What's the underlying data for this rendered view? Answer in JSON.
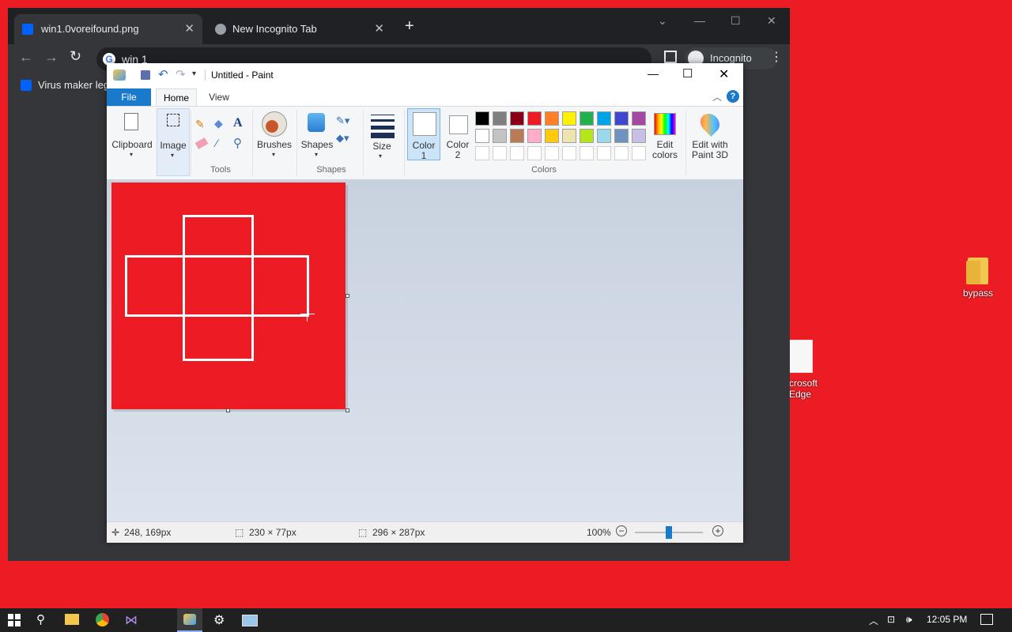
{
  "desktop": {
    "icons": [
      {
        "label": "bypass"
      },
      {
        "label": "crosoft\nEdge"
      }
    ]
  },
  "browser": {
    "tabs": [
      {
        "title": "win1.0voreifound.png"
      },
      {
        "title": "New Incognito Tab"
      }
    ],
    "omnibox_text": "win 1",
    "profile_label": "Incognito",
    "bookmark": "Virus maker legi"
  },
  "paint": {
    "title": "Untitled - Paint",
    "tabs": {
      "file": "File",
      "home": "Home",
      "view": "View"
    },
    "ribbon": {
      "clipboard": "Clipboard",
      "image": "Image",
      "tools_group": "Tools",
      "brushes": "Brushes",
      "shapes": "Shapes",
      "shapes_group": "Shapes",
      "size": "Size",
      "color1": "Color\n1",
      "color2": "Color\n2",
      "colors_group": "Colors",
      "edit_colors": "Edit\ncolors",
      "edit_paint3d": "Edit with\nPaint 3D"
    },
    "palette_row1": [
      "#000000",
      "#7f7f7f",
      "#880015",
      "#ed1c24",
      "#ff7f27",
      "#fff200",
      "#22b14c",
      "#00a2e8",
      "#3f48cc",
      "#a349a4"
    ],
    "palette_row2": [
      "#ffffff",
      "#c3c3c3",
      "#b97a57",
      "#ffaec9",
      "#ffc90e",
      "#efe4b0",
      "#b5e61d",
      "#99d9ea",
      "#7092be",
      "#c8bfe7"
    ],
    "canvas_color": "#ed1c24",
    "status": {
      "cursor_pos": "248, 169px",
      "selection_size": "230 × 77px",
      "image_size": "296 × 287px",
      "zoom": "100%"
    }
  },
  "taskbar": {
    "time": "12:05 PM"
  }
}
